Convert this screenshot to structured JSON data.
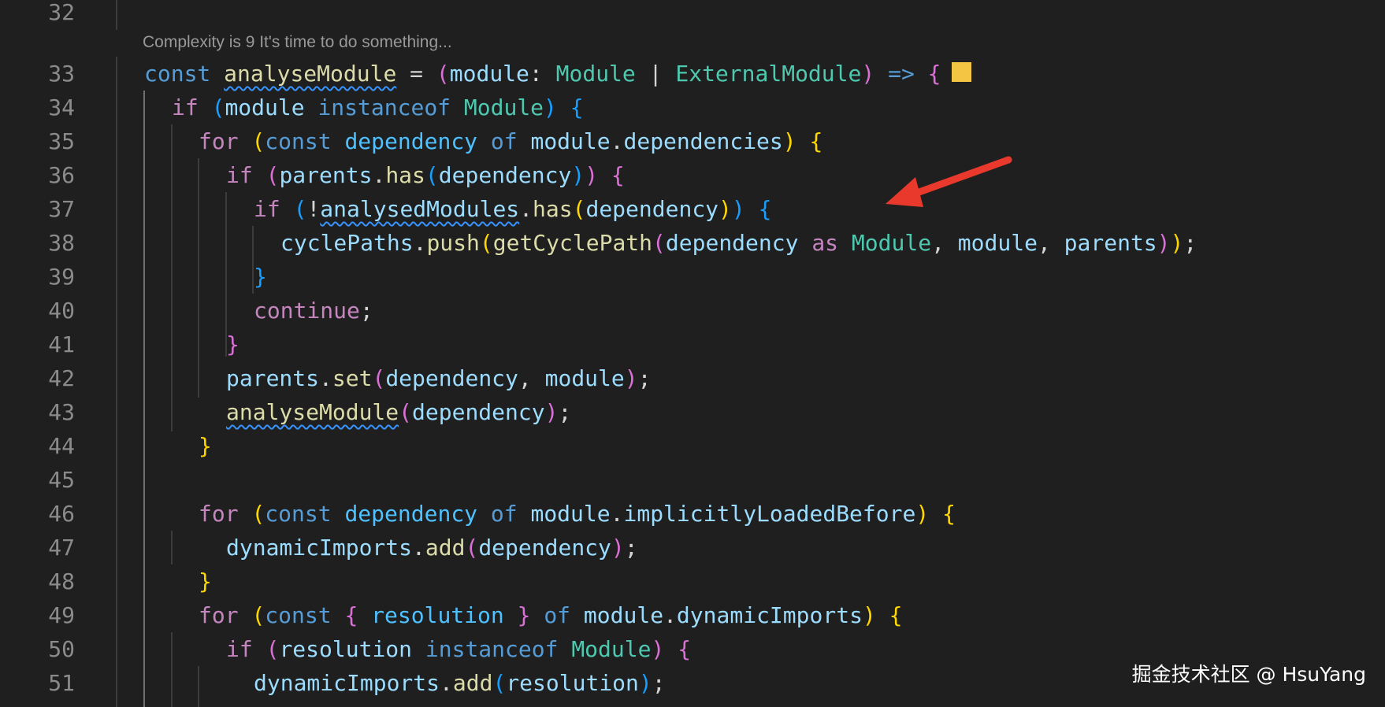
{
  "editor": {
    "codelens": "Complexity is 9 It's time to do something...",
    "swatch_color": "#f4c542",
    "line_numbers": [
      "32",
      "33",
      "34",
      "35",
      "36",
      "37",
      "38",
      "39",
      "40",
      "41",
      "42",
      "43",
      "44",
      "45",
      "46",
      "47",
      "48",
      "49",
      "50",
      "51"
    ],
    "tokens": {
      "const": "const",
      "if": "if",
      "for": "for",
      "of": "of",
      "as": "as",
      "instanceof": "instanceof",
      "continue": "continue",
      "analyseModule": "analyseModule",
      "module": "module",
      "Module": "Module",
      "ExternalModule": "ExternalModule",
      "dependency": "dependency",
      "dependencies": "dependencies",
      "parents": "parents",
      "has": "has",
      "set": "set",
      "add": "add",
      "push": "push",
      "analysedModules": "analysedModules",
      "cyclePaths": "cyclePaths",
      "getCyclePath": "getCyclePath",
      "implicitlyLoadedBefore": "implicitlyLoadedBefore",
      "dynamicImports": "dynamicImports",
      "resolution": "resolution"
    }
  },
  "annotation": {
    "arrow_color": "#e8392c"
  },
  "watermark": "掘金技术社区 @ HsuYang"
}
